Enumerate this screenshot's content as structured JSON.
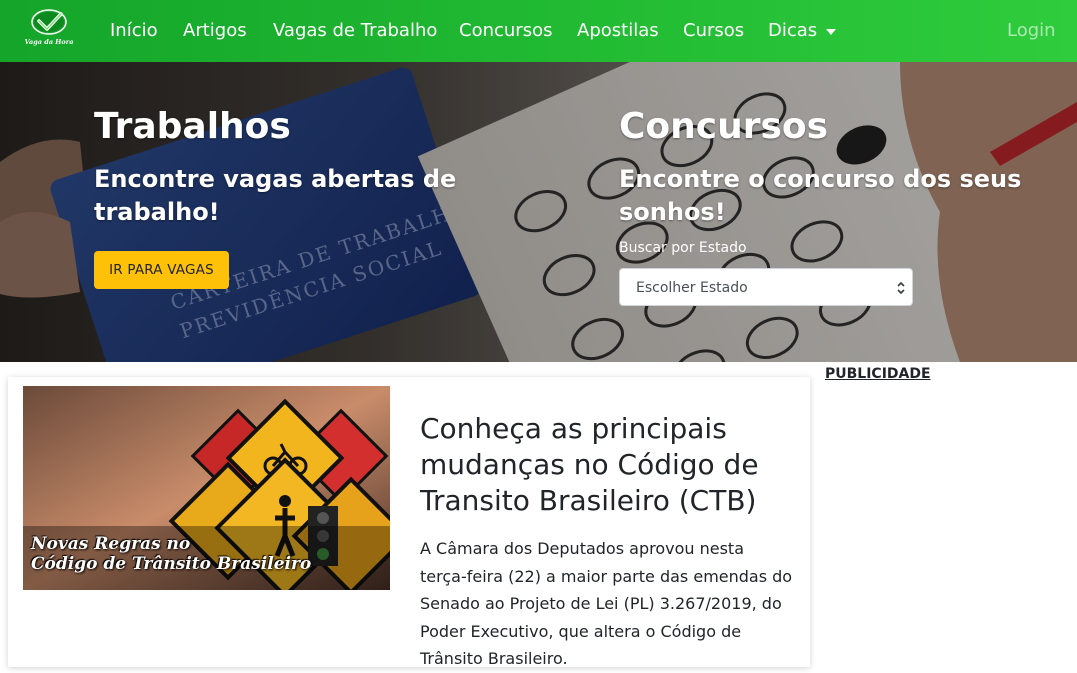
{
  "brand": {
    "logo_text": "Vaga da Hora"
  },
  "nav": {
    "items": [
      {
        "label": "Início"
      },
      {
        "label": "Artigos"
      },
      {
        "label": "Vagas de Trabalho"
      },
      {
        "label": "Concursos"
      },
      {
        "label": "Apostilas"
      },
      {
        "label": "Cursos"
      },
      {
        "label": "Dicas"
      }
    ],
    "login_label": "Login"
  },
  "hero": {
    "trabalhos": {
      "title": "Trabalhos",
      "subtitle_line1": "Encontre vagas abertas de",
      "subtitle_line2": "trabalho!",
      "button_label": "IR PARA VAGAS"
    },
    "concursos": {
      "title": "Concursos",
      "subtitle_line1": "Encontre o concurso dos seus",
      "subtitle_line2": "sonhos!",
      "search_label": "Buscar por Estado",
      "select_value": "Escolher Estado"
    }
  },
  "article": {
    "image_caption_line1": "Novas Regras no",
    "image_caption_line2": "Código de Trânsito Brasileiro",
    "title": "Conheça as principais mudanças no Código de Transito Brasileiro (CTB)",
    "excerpt": "A Câmara dos Deputados aprovou nesta terça-feira (22) a maior parte das emendas do Senado ao Projeto de Lei (PL) 3.267/2019, do Poder Executivo, que altera o Código de Trânsito Brasileiro."
  },
  "sidebar": {
    "ad_label": "PUBLICIDADE"
  },
  "colors": {
    "nav_green": "#22bb33",
    "button_yellow": "#ffc107"
  }
}
